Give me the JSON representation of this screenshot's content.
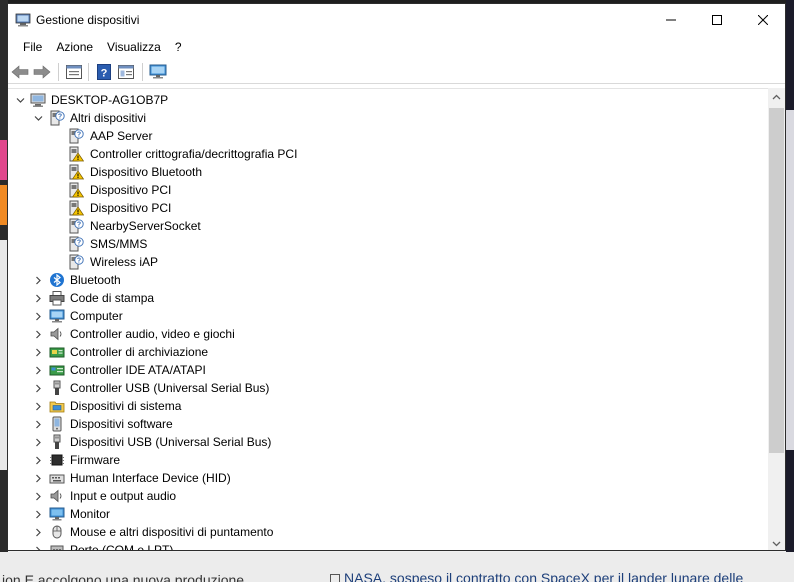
{
  "window": {
    "title": "Gestione dispositivi"
  },
  "menu": [
    "File",
    "Azione",
    "Visualizza",
    "?"
  ],
  "toolbar_icons": [
    "back-arrow-icon",
    "forward-arrow-icon",
    "properties-window-icon",
    "help-icon",
    "details-view-icon",
    "monitor-scan-icon"
  ],
  "tree": {
    "root": "DESKTOP-AG1OB7P",
    "expanded_category": {
      "label": "Altri dispositivi",
      "icon": "unknown-device-icon",
      "children": [
        {
          "label": "AAP Server",
          "icon": "unknown-device-icon"
        },
        {
          "label": "Controller crittografia/decrittografia PCI",
          "icon": "warning-device-icon"
        },
        {
          "label": "Dispositivo Bluetooth",
          "icon": "warning-device-icon"
        },
        {
          "label": "Dispositivo PCI",
          "icon": "warning-device-icon"
        },
        {
          "label": "Dispositivo PCI",
          "icon": "warning-device-icon"
        },
        {
          "label": "NearbyServerSocket",
          "icon": "unknown-device-icon"
        },
        {
          "label": "SMS/MMS",
          "icon": "unknown-device-icon"
        },
        {
          "label": "Wireless iAP",
          "icon": "unknown-device-icon"
        }
      ]
    },
    "categories": [
      {
        "label": "Bluetooth",
        "icon": "bluetooth-icon"
      },
      {
        "label": "Code di stampa",
        "icon": "printer-icon"
      },
      {
        "label": "Computer",
        "icon": "computer-icon"
      },
      {
        "label": "Controller audio, video e giochi",
        "icon": "speaker-icon"
      },
      {
        "label": "Controller di archiviazione",
        "icon": "storage-controller-icon"
      },
      {
        "label": "Controller IDE ATA/ATAPI",
        "icon": "ide-controller-icon"
      },
      {
        "label": "Controller USB (Universal Serial Bus)",
        "icon": "usb-icon"
      },
      {
        "label": "Dispositivi di sistema",
        "icon": "system-folder-icon"
      },
      {
        "label": "Dispositivi software",
        "icon": "software-device-icon"
      },
      {
        "label": "Dispositivi USB (Universal Serial Bus)",
        "icon": "usb-icon"
      },
      {
        "label": "Firmware",
        "icon": "firmware-chip-icon"
      },
      {
        "label": "Human Interface Device (HID)",
        "icon": "hid-keyboard-icon"
      },
      {
        "label": "Input e output audio",
        "icon": "speaker-icon"
      },
      {
        "label": "Monitor",
        "icon": "monitor-icon"
      },
      {
        "label": "Mouse e altri dispositivi di puntamento",
        "icon": "mouse-icon"
      },
      {
        "label": "Porte (COM e LPT)",
        "icon": "port-icon"
      }
    ]
  },
  "background": {
    "bottom_left_text": "ion E accolgono una nuova produzione",
    "bottom_right_text": "NASA, sospeso il contratto con SpaceX per il lander lunare delle"
  }
}
